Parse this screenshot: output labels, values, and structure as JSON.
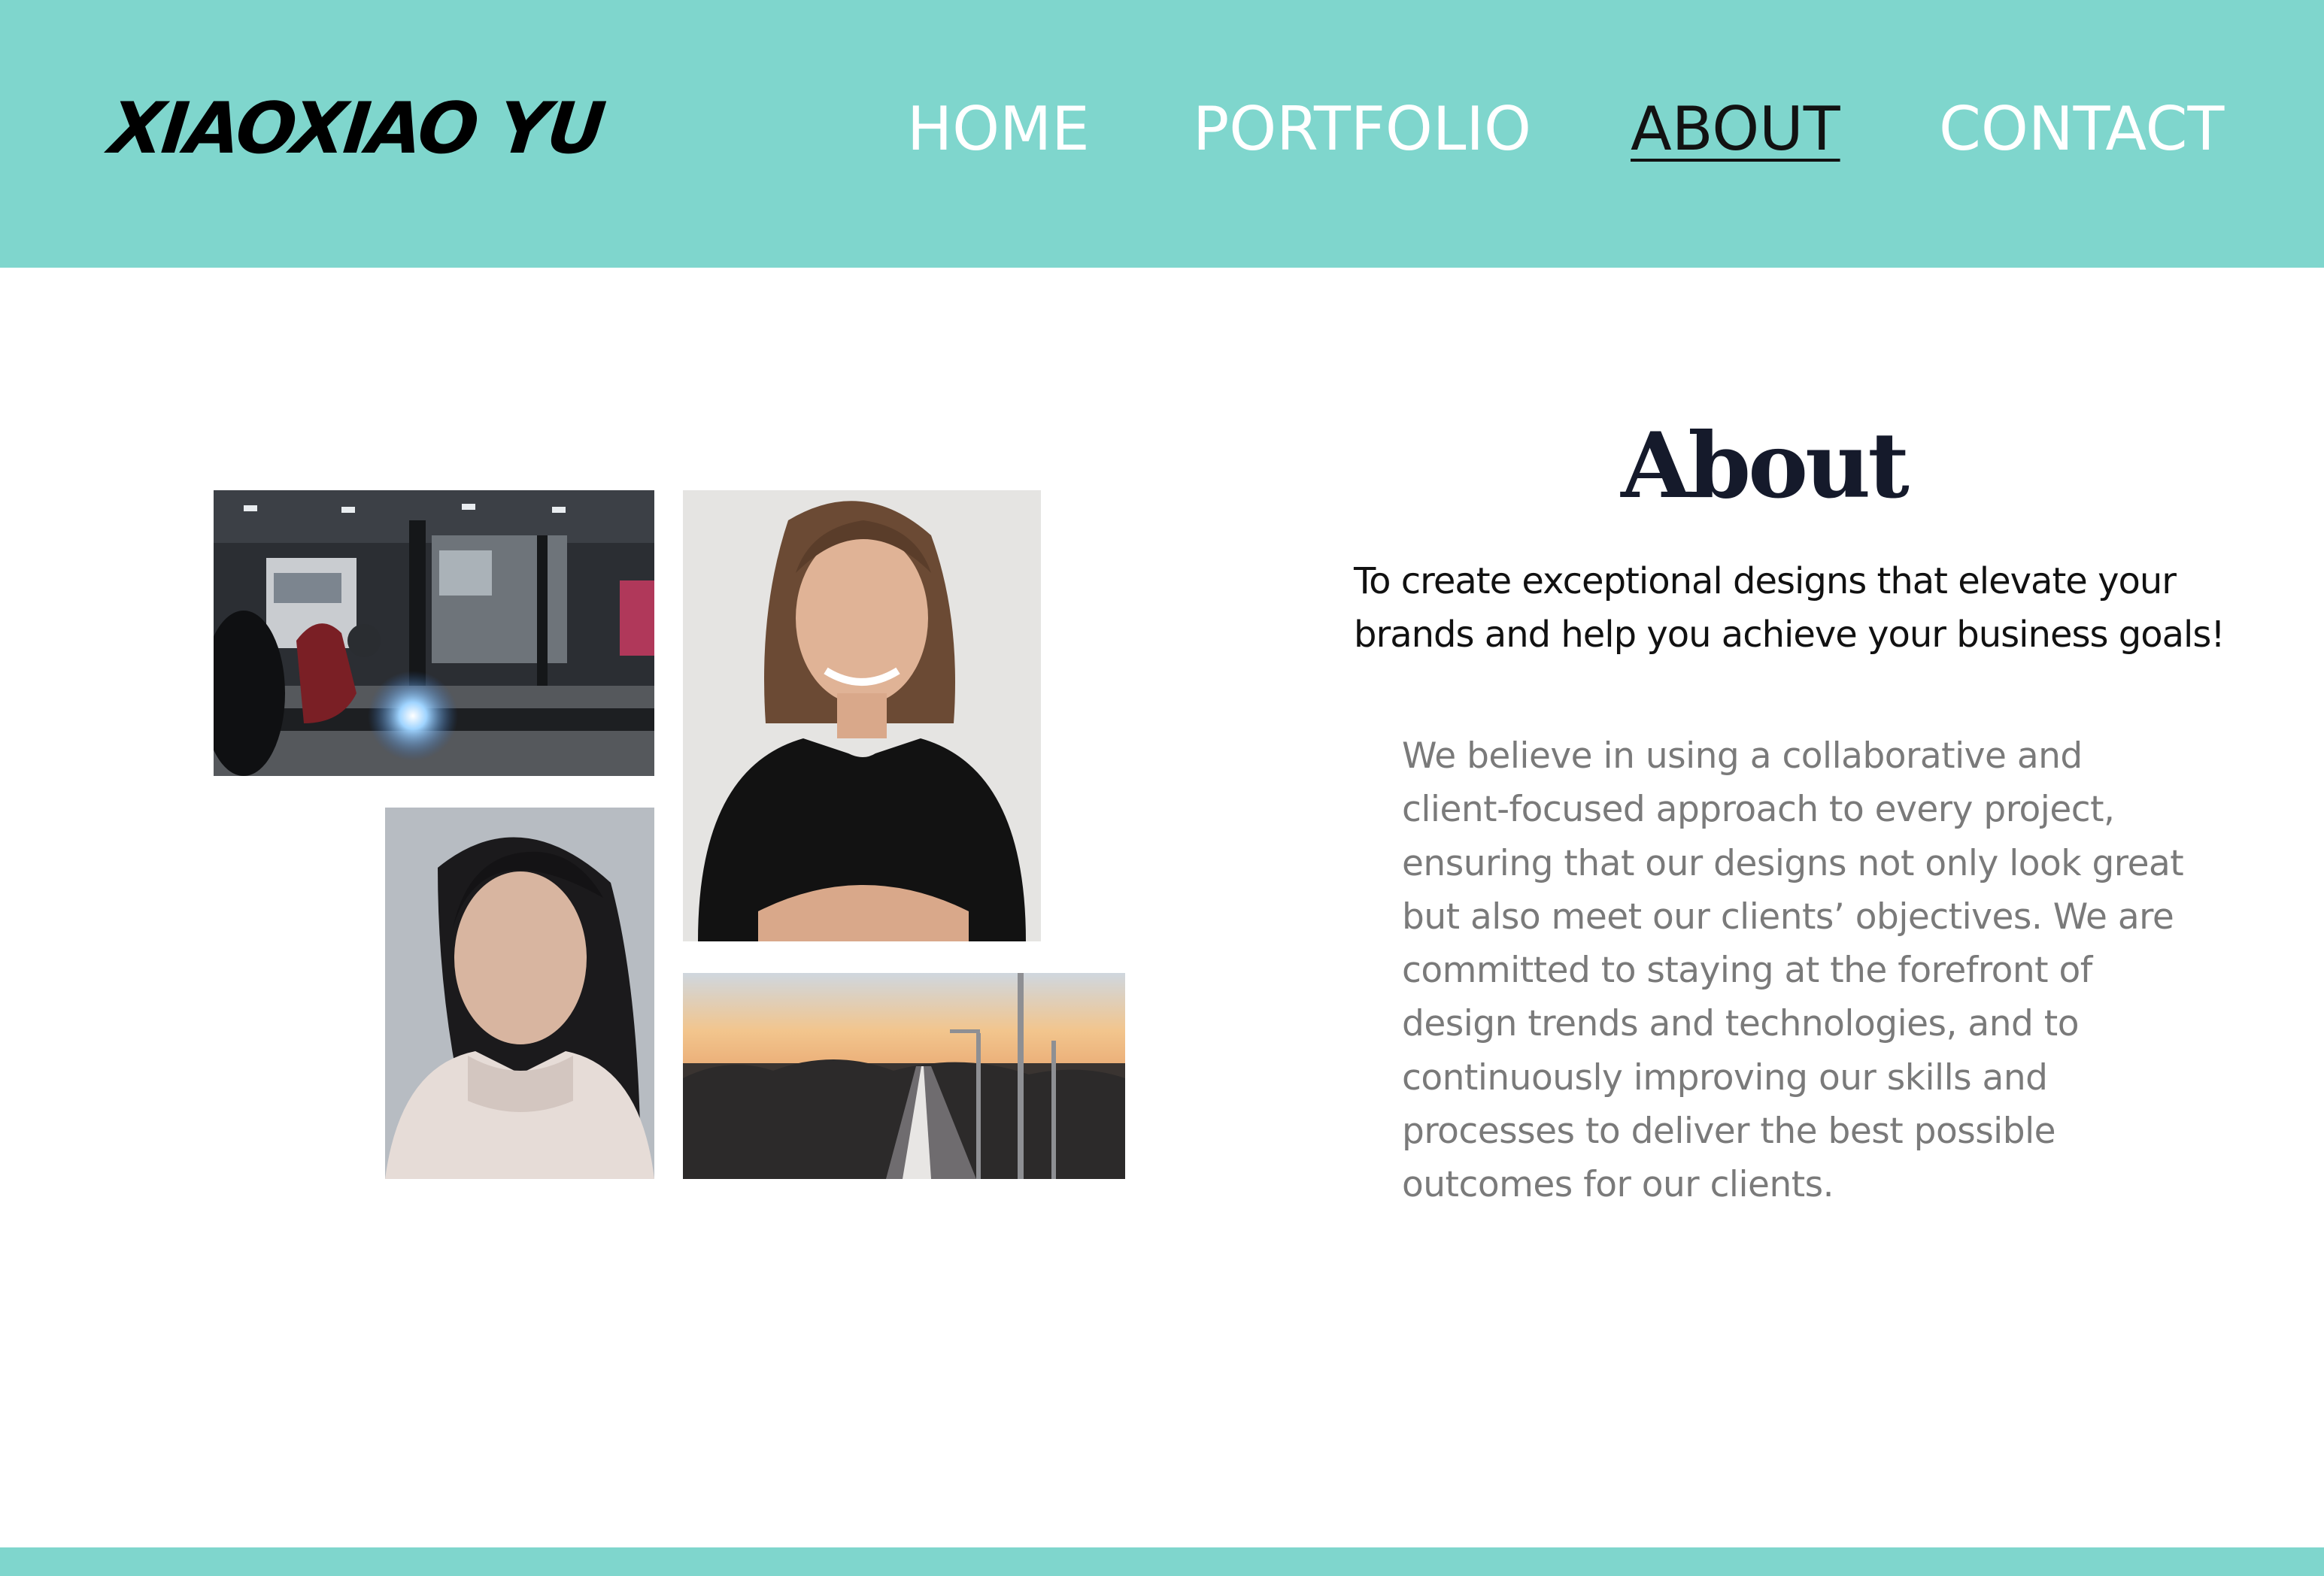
{
  "site": {
    "logo_text": "XIAOXIAO YU"
  },
  "nav": {
    "items": [
      {
        "label": "HOME",
        "active": false
      },
      {
        "label": "PORTFOLIO",
        "active": false
      },
      {
        "label": "ABOUT",
        "active": true
      },
      {
        "label": "CONTACT",
        "active": false
      }
    ]
  },
  "about": {
    "title": "About",
    "tagline": "To create exceptional designs that elevate your brands and help you achieve your business goals!",
    "body": "We believe in using a collaborative and client-focused approach to every project, ensuring that our designs not only look great but also meet our clients’ objectives. We are committed to staying at the forefront of design trends and technologies, and to continuously improving our skills and processes to deliver the best possible outcomes for our clients."
  },
  "gallery": {
    "photos": [
      {
        "subject": "welder working in a truck garage"
      },
      {
        "subject": "smiling woman with arms crossed"
      },
      {
        "subject": "portrait of a woman in a knit sweater"
      },
      {
        "subject": "highway at sunset"
      }
    ]
  },
  "colors": {
    "header_bg": "#7fd6cd",
    "nav_text": "#ffffff",
    "nav_active": "#121212",
    "title": "#151a2b",
    "body_text": "#7a7a7a"
  }
}
